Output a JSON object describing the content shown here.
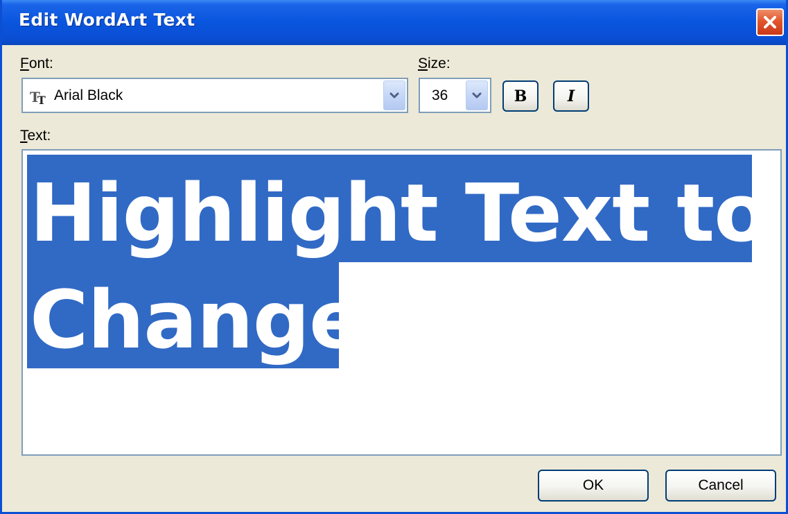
{
  "window": {
    "title": "Edit WordArt Text"
  },
  "font": {
    "label_accel": "F",
    "label_rest": "ont:",
    "value": "Arial Black"
  },
  "size": {
    "label_accel": "S",
    "label_rest": "ize:",
    "value": "36"
  },
  "format": {
    "bold_label": "B",
    "italic_label": "I"
  },
  "text": {
    "label_accel": "T",
    "label_rest": "ext:",
    "lines": [
      "Highlight Text to",
      "Change"
    ]
  },
  "buttons": {
    "ok_label": "OK",
    "cancel_label": "Cancel"
  },
  "icons": {
    "close": "close-icon",
    "dropdown": "chevron-down-icon",
    "font_type": "truetype-font-icon"
  },
  "colors": {
    "titlebar": "#0a55de",
    "selection": "#316ac5",
    "close_button": "#e2562c",
    "dialog_background": "#ece9d8"
  }
}
